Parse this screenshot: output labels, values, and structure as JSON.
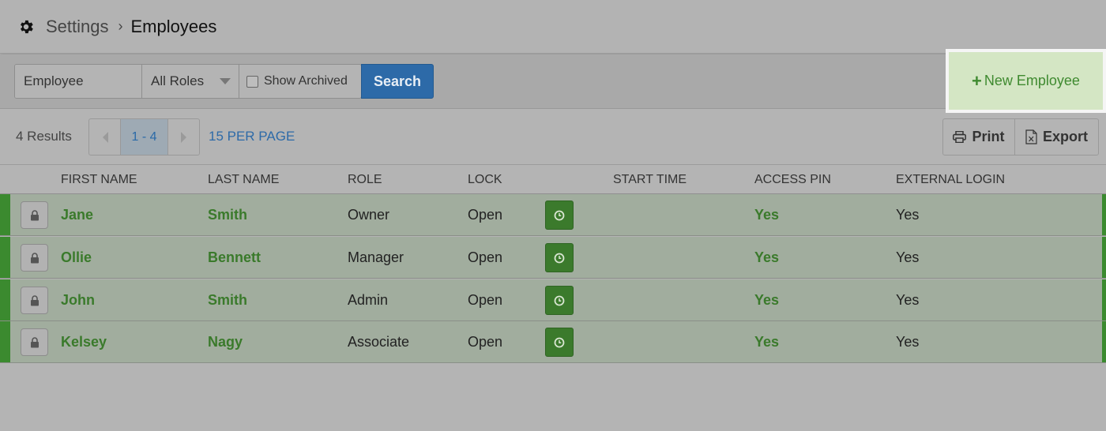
{
  "header": {
    "breadcrumb_parent": "Settings",
    "breadcrumb_separator": "›",
    "breadcrumb_current": "Employees"
  },
  "toolbar": {
    "employee_placeholder": "Employee",
    "roles_selected": "All Roles",
    "show_archived_label": "Show Archived",
    "search_label": "Search",
    "new_employee_label": "New Employee"
  },
  "results": {
    "count_label": "4 Results",
    "page_range": "1 - 4",
    "per_page_label": "15 PER PAGE",
    "print_label": "Print",
    "export_label": "Export"
  },
  "table": {
    "columns": {
      "first_name": "FIRST NAME",
      "last_name": "LAST NAME",
      "role": "ROLE",
      "lock": "LOCK",
      "start_time": "START TIME",
      "access_pin": "ACCESS PIN",
      "external_login": "EXTERNAL LOGIN"
    },
    "rows": [
      {
        "first_name": "Jane",
        "last_name": "Smith",
        "role": "Owner",
        "lock": "Open",
        "start_time": "",
        "access_pin": "Yes",
        "external_login": "Yes"
      },
      {
        "first_name": "Ollie",
        "last_name": "Bennett",
        "role": "Manager",
        "lock": "Open",
        "start_time": "",
        "access_pin": "Yes",
        "external_login": "Yes"
      },
      {
        "first_name": "John",
        "last_name": "Smith",
        "role": "Admin",
        "lock": "Open",
        "start_time": "",
        "access_pin": "Yes",
        "external_login": "Yes"
      },
      {
        "first_name": "Kelsey",
        "last_name": "Nagy",
        "role": "Associate",
        "lock": "Open",
        "start_time": "",
        "access_pin": "Yes",
        "external_login": "Yes"
      }
    ]
  },
  "colors": {
    "accent_blue": "#2d6aa8",
    "accent_green": "#3a7a2b",
    "highlight_green": "#d4e6c4"
  },
  "icons": {
    "header": "gear-icon",
    "new_employee": "plus-icon",
    "print": "printer-icon",
    "export": "excel-file-icon",
    "row_lock": "padlock-icon",
    "row_clock": "clock-icon"
  }
}
